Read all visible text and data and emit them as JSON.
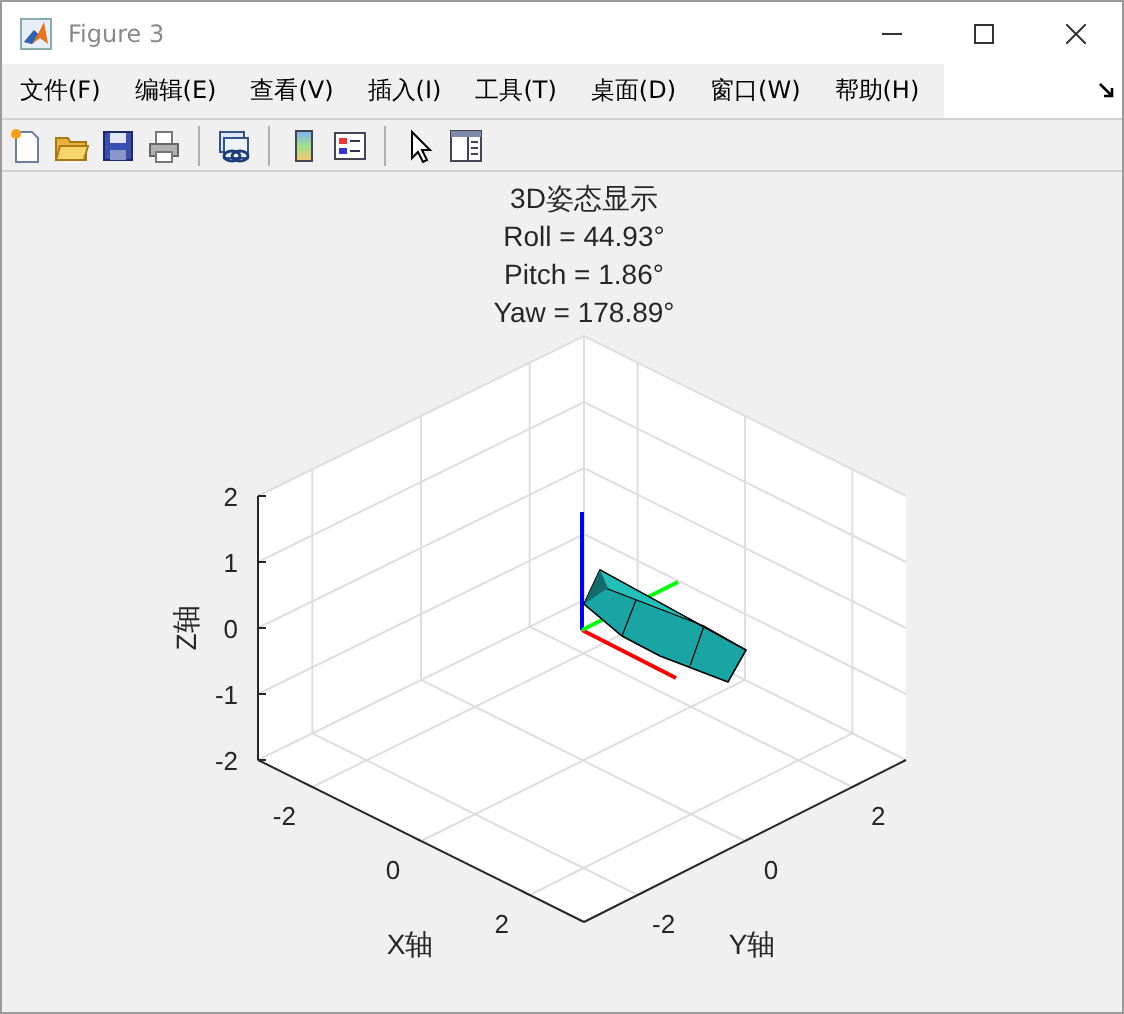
{
  "window": {
    "title": "Figure 3"
  },
  "menu": [
    "文件(F)",
    "编辑(E)",
    "查看(V)",
    "插入(I)",
    "工具(T)",
    "桌面(D)",
    "窗口(W)",
    "帮助(H)"
  ],
  "toolbar": [
    {
      "kind": "new"
    },
    {
      "kind": "open"
    },
    {
      "kind": "save"
    },
    {
      "kind": "print"
    },
    {
      "kind": "separator"
    },
    {
      "kind": "link"
    },
    {
      "kind": "separator"
    },
    {
      "kind": "colorbar"
    },
    {
      "kind": "legend"
    },
    {
      "kind": "separator"
    },
    {
      "kind": "pointer"
    },
    {
      "kind": "panel"
    }
  ],
  "axes": {
    "title": [
      "3D姿态显示",
      "Roll = 44.93°",
      "Pitch = 1.86°",
      "Yaw = 178.89°"
    ],
    "xlabel": "X轴",
    "ylabel": "Y轴",
    "zlabel": "Z轴",
    "xticks": [
      "-2",
      "0",
      "2"
    ],
    "yticks": [
      "-2",
      "0",
      "2"
    ],
    "zticks": [
      "2",
      "1",
      "0",
      "-1",
      "-2"
    ]
  }
}
